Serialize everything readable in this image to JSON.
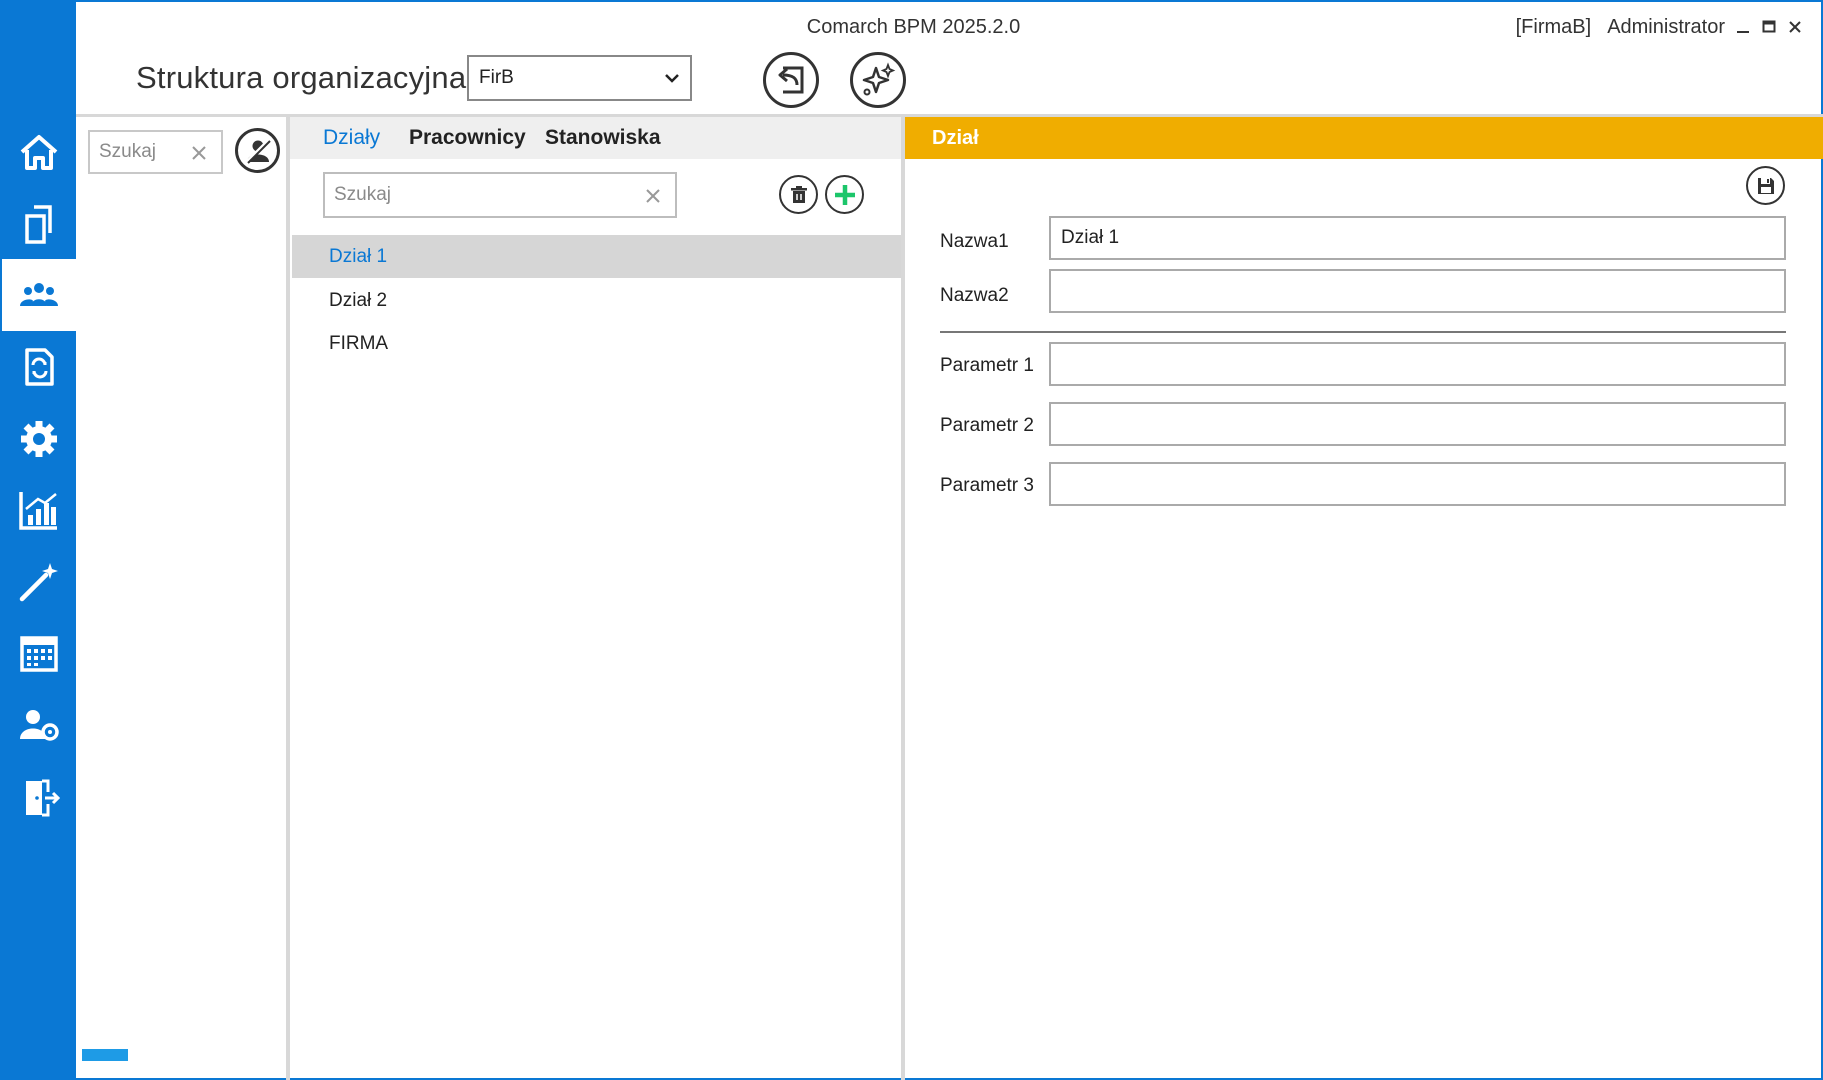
{
  "window": {
    "title": "Comarch BPM 2025.2.0",
    "company": "[FirmaB]",
    "user": "Administrator"
  },
  "sidebar": {
    "items": [
      {
        "icon": "home-icon"
      },
      {
        "icon": "documents-icon"
      },
      {
        "icon": "organization-users-icon",
        "active": true
      },
      {
        "icon": "document-sync-icon"
      },
      {
        "icon": "settings-gear-icon"
      },
      {
        "icon": "analytics-chart-icon"
      },
      {
        "icon": "magic-wand-icon"
      },
      {
        "icon": "calendar-icon"
      },
      {
        "icon": "user-settings-icon"
      },
      {
        "icon": "logout-door-icon"
      }
    ]
  },
  "header": {
    "page_title": "Struktura organizacyjna",
    "company_select": "FirB"
  },
  "left_panel": {
    "search_placeholder": "Szukaj"
  },
  "middle_panel": {
    "tabs": [
      {
        "label": "Działy",
        "active": true
      },
      {
        "label": "Pracownicy"
      },
      {
        "label": "Stanowiska"
      }
    ],
    "search_placeholder": "Szukaj",
    "items": [
      {
        "label": "Dział 1",
        "selected": true
      },
      {
        "label": "Dział 2"
      },
      {
        "label": "FIRMA"
      }
    ]
  },
  "detail": {
    "title": "Dział",
    "fields": [
      {
        "label": "Nazwa1",
        "value": "Dział 1"
      },
      {
        "label": "Nazwa2",
        "value": ""
      },
      {
        "label": "Parametr 1",
        "value": ""
      },
      {
        "label": "Parametr 2",
        "value": ""
      },
      {
        "label": "Parametr 3",
        "value": ""
      }
    ]
  },
  "colors": {
    "sidebar": "#0a78d4",
    "accent": "#0a78d4",
    "detail_header": "#f0ad00",
    "add_button": "#1cc66a"
  }
}
